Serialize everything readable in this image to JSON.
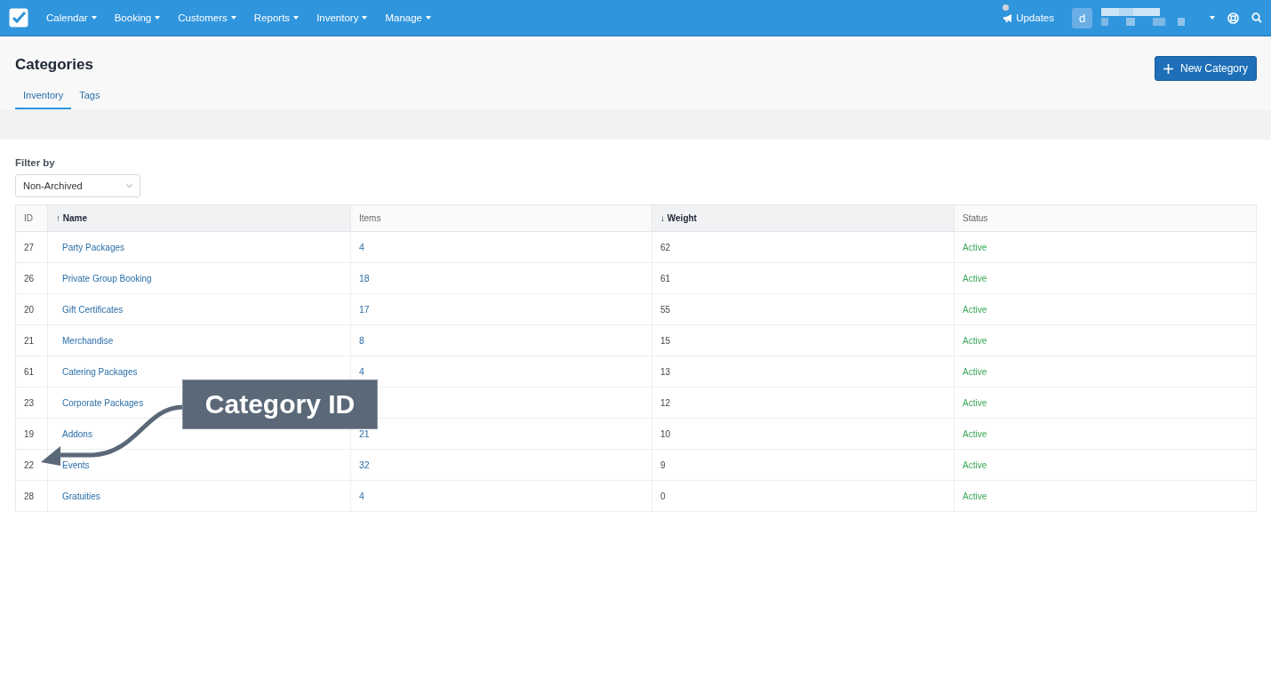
{
  "navbar": {
    "menus": [
      {
        "label": "Calendar"
      },
      {
        "label": "Booking"
      },
      {
        "label": "Customers"
      },
      {
        "label": "Reports"
      },
      {
        "label": "Inventory"
      },
      {
        "label": "Manage"
      }
    ],
    "updates": "Updates",
    "avatar": "d"
  },
  "page": {
    "title": "Categories",
    "new_button": "New Category",
    "tabs": [
      {
        "label": "Inventory",
        "selected": true
      },
      {
        "label": "Tags",
        "selected": false
      }
    ]
  },
  "filter": {
    "label": "Filter by",
    "value": "Non-Archived"
  },
  "table": {
    "columns": [
      {
        "label": "ID",
        "sorted": false
      },
      {
        "label": "Name",
        "sorted": true,
        "sort_arrow": "↑"
      },
      {
        "label": "Items",
        "sorted": false
      },
      {
        "label": "Weight",
        "sorted": true,
        "sort_arrow": "↓"
      },
      {
        "label": "Status",
        "sorted": false
      }
    ],
    "rows": [
      {
        "id": "27",
        "name": "Party Packages",
        "items": "4",
        "weight": "62",
        "status": {
          "label": "Active",
          "kind": "active"
        }
      },
      {
        "id": "26",
        "name": "Private Group Booking",
        "items": "18",
        "weight": "61",
        "status": {
          "label": "Active",
          "kind": "active"
        }
      },
      {
        "id": "20",
        "name": "Gift Certificates",
        "items": "17",
        "weight": "55",
        "status": {
          "label": "Active",
          "kind": "active"
        }
      },
      {
        "id": "21",
        "name": "Merchandise",
        "items": "8",
        "weight": "15",
        "status": {
          "label": "Active",
          "kind": "active"
        }
      },
      {
        "id": "61",
        "name": "Catering Packages",
        "items": "4",
        "weight": "13",
        "status": {
          "label": "Active",
          "kind": "active"
        }
      },
      {
        "id": "23",
        "name": "Corporate Packages",
        "weight": "12",
        "status": {
          "label": "Active",
          "kind": "active"
        }
      },
      {
        "id": "19",
        "name": "Addons",
        "items": "21",
        "weight": "10",
        "status": {
          "label": "Active",
          "kind": "active"
        }
      },
      {
        "id": "22",
        "name": "Events",
        "items": "32",
        "weight": "9",
        "status": {
          "label": "Active",
          "kind": "active"
        }
      },
      {
        "id": "28",
        "name": "Gratuities",
        "items": "4",
        "weight": "0",
        "status": {
          "label": "Active",
          "kind": "active"
        }
      }
    ]
  },
  "annotation": {
    "label": "Category ID"
  }
}
